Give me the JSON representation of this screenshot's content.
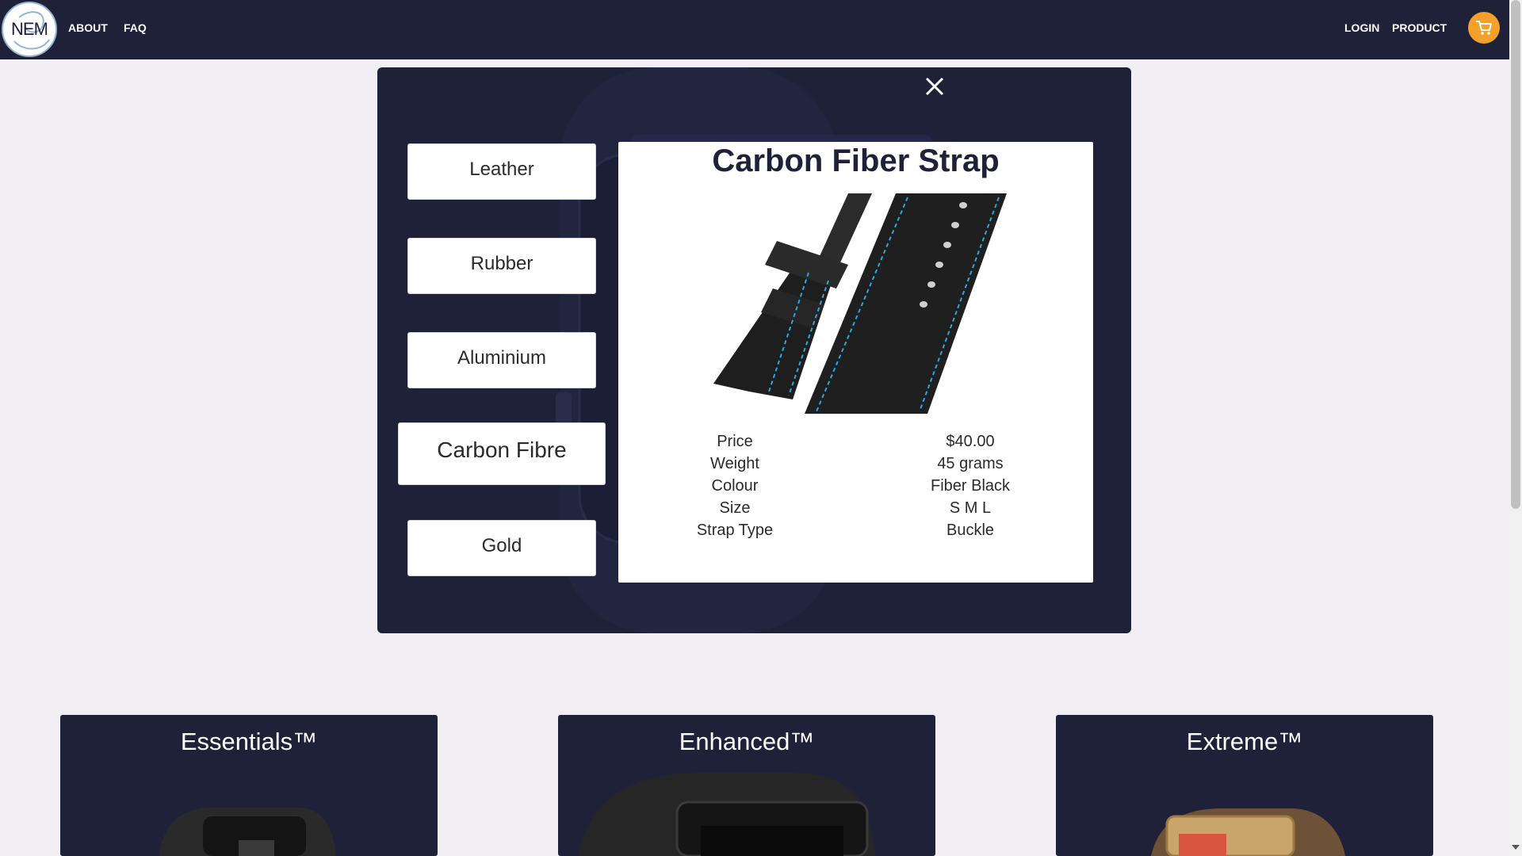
{
  "nav": {
    "logo_text": "NEM",
    "about": "ABOUT",
    "faq": "FAQ",
    "login": "LOGIN",
    "product": "PRODUCT",
    "cart_icon": "cart-icon"
  },
  "modal": {
    "close_icon": "close-icon",
    "strap_options": [
      "Leather",
      "Rubber",
      "Aluminium",
      "Carbon Fibre",
      "Gold"
    ],
    "selected_option": "Carbon Fibre",
    "detail": {
      "title": "Carbon Fiber Strap",
      "specs": [
        {
          "label": "Price",
          "value": "$40.00"
        },
        {
          "label": "Weight",
          "value": "45 grams"
        },
        {
          "label": "Colour",
          "value": "Fiber Black"
        },
        {
          "label": "Size",
          "value": "S M L"
        },
        {
          "label": "Strap Type",
          "value": "Buckle"
        }
      ]
    }
  },
  "products": [
    {
      "title": "Essentials™"
    },
    {
      "title": "Enhanced™"
    },
    {
      "title": "Extreme™"
    }
  ],
  "colors": {
    "navy": "#1f2139",
    "cart_orange": "#f3a12b",
    "page_bg": "#f1eff3",
    "stitch_blue": "#29a8e0"
  }
}
